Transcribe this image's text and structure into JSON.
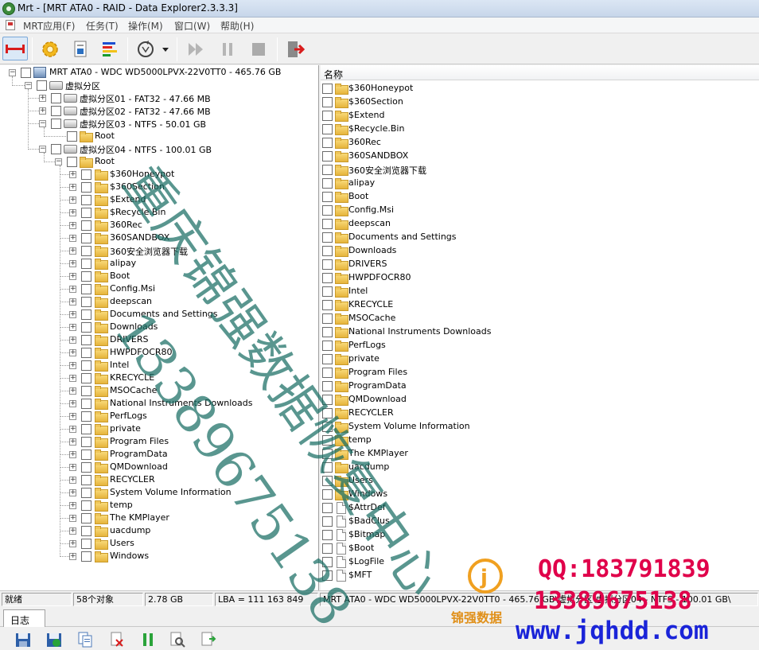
{
  "window": {
    "title": "Mrt - [MRT ATA0 - RAID - Data Explorer2.3.3.3]"
  },
  "menu": [
    "MRT应用(F)",
    "任务(T)",
    "操作(M)",
    "窗口(W)",
    "帮助(H)"
  ],
  "toolbar": {
    "buttons": [
      "connect-icon",
      "settings-gear-icon",
      "document-properties-icon",
      "color-bars-icon",
      "refresh-icon",
      "dropdown-arrow-icon",
      "fast-forward-icon",
      "pause-icon",
      "stop-icon",
      "exit-icon"
    ]
  },
  "tree": {
    "root": "MRT ATA0 - WDC WD5000LPVX-22V0TT0 - 465.76 GB",
    "virtual": "虚拟分区",
    "p1": "虚拟分区01 - FAT32 - 47.66 MB",
    "p2": "虚拟分区02 - FAT32 - 47.66 MB",
    "p3": "虚拟分区03 - NTFS - 50.01 GB",
    "p3root": "Root",
    "p4": "虚拟分区04 - NTFS - 100.01 GB",
    "p4root": "Root",
    "folders": [
      "$360Honeypot",
      "$360Section",
      "$Extend",
      "$Recycle.Bin",
      "360Rec",
      "360SANDBOX",
      "360安全浏览器下载",
      "alipay",
      "Boot",
      "Config.Msi",
      "deepscan",
      "Documents and Settings",
      "Downloads",
      "DRIVERS",
      "HWPDFOCR80",
      "Intel",
      "KRECYCLE",
      "MSOCache",
      "National Instruments Downloads",
      "PerfLogs",
      "private",
      "Program Files",
      "ProgramData",
      "QMDownload",
      "RECYCLER",
      "System Volume Information",
      "temp",
      "The KMPlayer",
      "uacdump",
      "Users",
      "Windows"
    ]
  },
  "list": {
    "header": "名称",
    "items": [
      {
        "name": "$360Honeypot",
        "type": "folder"
      },
      {
        "name": "$360Section",
        "type": "folder"
      },
      {
        "name": "$Extend",
        "type": "folder"
      },
      {
        "name": "$Recycle.Bin",
        "type": "folder"
      },
      {
        "name": "360Rec",
        "type": "folder"
      },
      {
        "name": "360SANDBOX",
        "type": "folder"
      },
      {
        "name": "360安全浏览器下载",
        "type": "folder"
      },
      {
        "name": "alipay",
        "type": "folder"
      },
      {
        "name": "Boot",
        "type": "folder"
      },
      {
        "name": "Config.Msi",
        "type": "folder"
      },
      {
        "name": "deepscan",
        "type": "folder"
      },
      {
        "name": "Documents and Settings",
        "type": "folder"
      },
      {
        "name": "Downloads",
        "type": "folder"
      },
      {
        "name": "DRIVERS",
        "type": "folder"
      },
      {
        "name": "HWPDFOCR80",
        "type": "folder"
      },
      {
        "name": "Intel",
        "type": "folder"
      },
      {
        "name": "KRECYCLE",
        "type": "folder"
      },
      {
        "name": "MSOCache",
        "type": "folder"
      },
      {
        "name": "National Instruments Downloads",
        "type": "folder"
      },
      {
        "name": "PerfLogs",
        "type": "folder"
      },
      {
        "name": "private",
        "type": "folder"
      },
      {
        "name": "Program Files",
        "type": "folder"
      },
      {
        "name": "ProgramData",
        "type": "folder"
      },
      {
        "name": "QMDownload",
        "type": "folder"
      },
      {
        "name": "RECYCLER",
        "type": "folder"
      },
      {
        "name": "System Volume Information",
        "type": "folder"
      },
      {
        "name": "temp",
        "type": "folder"
      },
      {
        "name": "The KMPlayer",
        "type": "folder"
      },
      {
        "name": "uacdump",
        "type": "folder"
      },
      {
        "name": "Users",
        "type": "folder"
      },
      {
        "name": "Windows",
        "type": "folder"
      },
      {
        "name": "$AttrDef",
        "type": "file"
      },
      {
        "name": "$BadClus",
        "type": "file"
      },
      {
        "name": "$Bitmap",
        "type": "file"
      },
      {
        "name": "$Boot",
        "type": "file"
      },
      {
        "name": "$LogFile",
        "type": "file"
      },
      {
        "name": "$MFT",
        "type": "file"
      }
    ]
  },
  "status": {
    "ready": "就绪",
    "count": "58个对象",
    "size": "2.78 GB",
    "lba": "LBA = 111 163 849",
    "path": "MRT ATA0 - WDC WD5000LPVX-22V0TT0 - 465.76 GB\\虚拟分区\\虚拟分区04 - NTFS - 100.01 GB\\"
  },
  "tabs": [
    "日志"
  ],
  "bottom_toolbar": [
    "save-icon",
    "save-as-icon",
    "copy-icon",
    "delete-icon",
    "pause-icon",
    "find-icon",
    "export-icon"
  ],
  "watermark": {
    "company": "重庆锦强数据恢复中心",
    "phone_big": "13389675138",
    "logo_text": "锦强数据",
    "qq": "QQ:183791839",
    "phone": "13389675138",
    "website": "www.jqhdd.com"
  }
}
